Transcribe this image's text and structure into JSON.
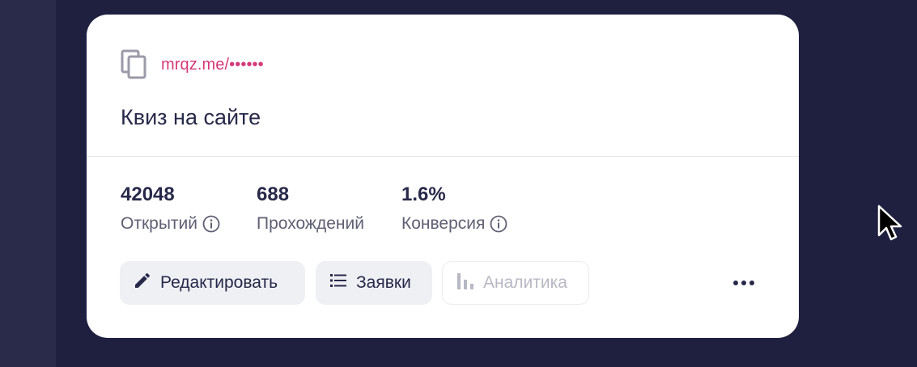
{
  "card": {
    "link": "mrqz.me/••••••",
    "title": "Квиз на сайте"
  },
  "stats": [
    {
      "value": "42048",
      "label": "Открытий",
      "has_info": true
    },
    {
      "value": "688",
      "label": "Прохождений",
      "has_info": false
    },
    {
      "value": "1.6%",
      "label": "Конверсия",
      "has_info": true
    }
  ],
  "actions": {
    "edit_label": "Редактировать",
    "leads_label": "Заявки",
    "analytics_label": "Аналитика"
  },
  "icons": {
    "copy": "copy-icon",
    "info": "info-icon",
    "pencil": "pencil-icon",
    "list": "list-icon",
    "bar_chart": "bar-chart-icon",
    "more": "more-horizontal-icon",
    "cursor": "mouse-cursor-icon"
  },
  "colors": {
    "background": "#1f2040",
    "card": "#ffffff",
    "link": "#d4397a",
    "text_primary": "#28294a",
    "text_secondary": "#5f6073",
    "disabled": "#b7b8c4",
    "button_bg": "#eef0f4"
  }
}
